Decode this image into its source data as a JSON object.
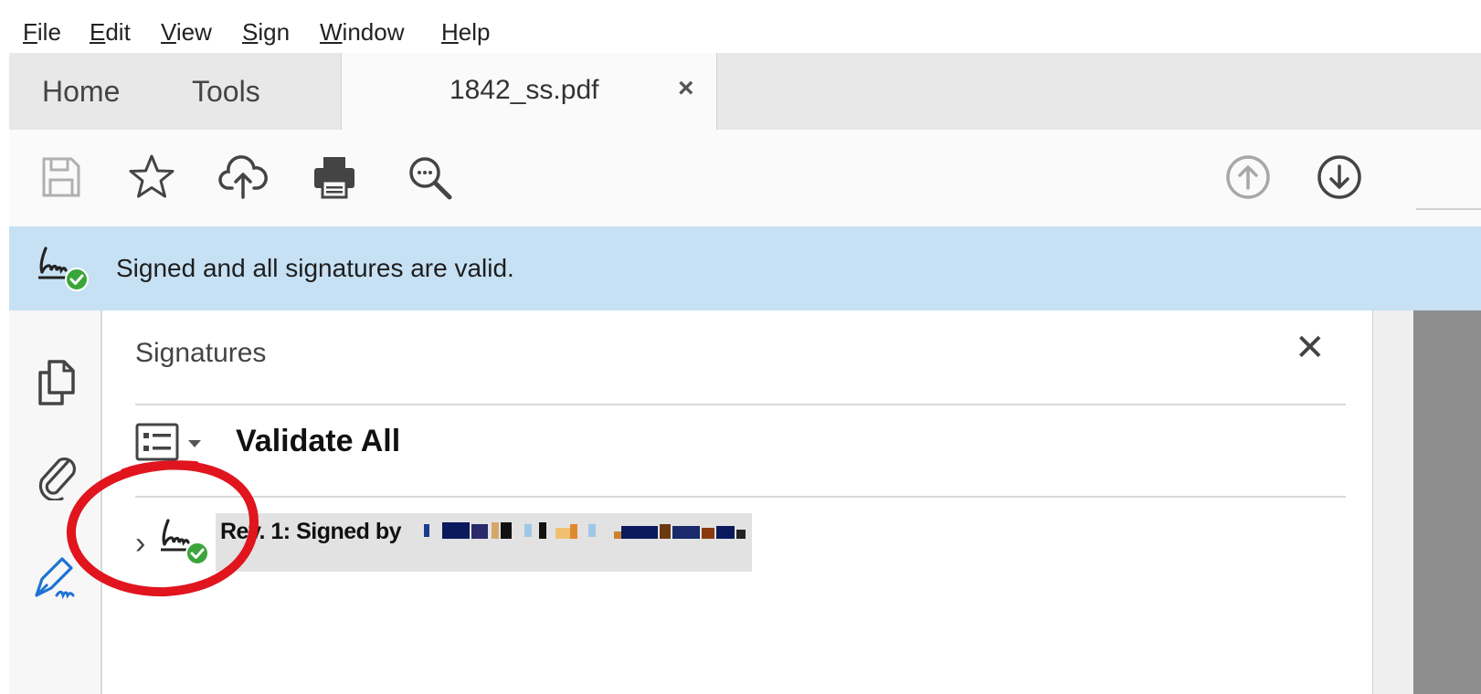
{
  "menubar": {
    "items": [
      {
        "mnemonic": "F",
        "rest": "ile"
      },
      {
        "mnemonic": "E",
        "rest": "dit"
      },
      {
        "mnemonic": "V",
        "rest": "iew"
      },
      {
        "mnemonic": "S",
        "rest": "ign"
      },
      {
        "mnemonic": "W",
        "rest": "indow"
      },
      {
        "mnemonic": "H",
        "rest": "elp"
      }
    ]
  },
  "tabs": {
    "home": "Home",
    "tools": "Tools",
    "document": "1842_ss.pdf",
    "close": "×"
  },
  "toolbar": {
    "icons": [
      "save-icon",
      "star-icon",
      "cloud-upload-icon",
      "print-icon",
      "search-icon",
      "page-up-icon",
      "page-down-icon"
    ]
  },
  "banner": {
    "message": "Signed and all signatures are valid."
  },
  "panel": {
    "title": "Signatures",
    "close": "✕",
    "validate_all": "Validate All",
    "signatures": [
      {
        "label": "Rev. 1: Signed by"
      }
    ]
  },
  "colors": {
    "banner_bg": "#c7e1f4",
    "valid_green": "#3aa53a",
    "annotation_red": "#e0151e",
    "active_rail_blue": "#1e73d2"
  }
}
